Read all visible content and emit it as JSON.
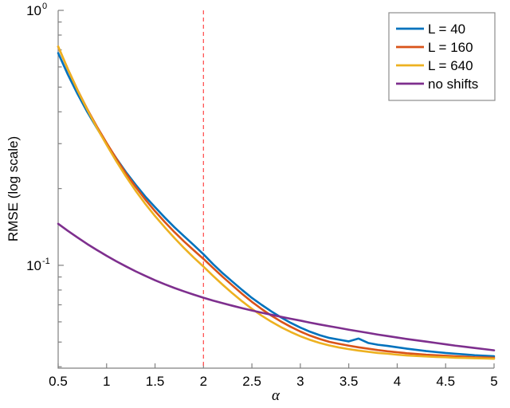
{
  "chart_data": {
    "type": "line",
    "title": "",
    "xlabel": "α",
    "ylabel": "RMSE (log scale)",
    "xscale": "linear",
    "yscale": "log",
    "xlim": [
      0.5,
      5
    ],
    "ylim": [
      0.0395,
      1.0
    ],
    "grid": false,
    "legend_position": "top-right",
    "xticks": [
      0.5,
      1,
      1.5,
      2,
      2.5,
      3,
      3.5,
      4,
      4.5,
      5
    ],
    "xticklabels": [
      "0.5",
      "1",
      "1.5",
      "2",
      "2.5",
      "3",
      "3.5",
      "4",
      "4.5",
      "5"
    ],
    "yticks": [
      1.0,
      0.1
    ],
    "yticklabels": [
      "10^0",
      "10^-1"
    ],
    "yticklabel_parts": [
      {
        "base": "10",
        "sup": "0",
        "value": 1.0
      },
      {
        "base": "10",
        "sup": "-1",
        "value": 0.1
      }
    ],
    "yminorticks": [
      0.9,
      0.8,
      0.7,
      0.6,
      0.5,
      0.4,
      0.3,
      0.2,
      0.09,
      0.08,
      0.07,
      0.06,
      0.05,
      0.04
    ],
    "annotations": [
      {
        "name": "alpha-threshold-line",
        "type": "vline",
        "x": 2,
        "color": "#FF5555",
        "style": "dashed"
      }
    ],
    "x": [
      0.5,
      0.6,
      0.7,
      0.8,
      0.9,
      1.0,
      1.1,
      1.2,
      1.3,
      1.4,
      1.5,
      1.6,
      1.7,
      1.8,
      1.9,
      2.0,
      2.1,
      2.2,
      2.3,
      2.4,
      2.5,
      2.6,
      2.7,
      2.8,
      2.9,
      3.0,
      3.1,
      3.2,
      3.3,
      3.4,
      3.5,
      3.6,
      3.7,
      3.8,
      3.9,
      4.0,
      4.1,
      4.2,
      4.3,
      4.4,
      4.5,
      4.6,
      4.7,
      4.8,
      4.9,
      5.0
    ],
    "series": [
      {
        "name": "L = 40",
        "color": "#0072BD",
        "values": [
          0.68,
          0.56,
          0.47,
          0.4,
          0.345,
          0.3,
          0.263,
          0.232,
          0.207,
          0.186,
          0.169,
          0.154,
          0.141,
          0.13,
          0.12,
          0.1105,
          0.101,
          0.093,
          0.0862,
          0.08,
          0.0745,
          0.07,
          0.066,
          0.0625,
          0.0595,
          0.057,
          0.0549,
          0.0532,
          0.0519,
          0.0511,
          0.0503,
          0.0516,
          0.0496,
          0.0488,
          0.0483,
          0.0477,
          0.0471,
          0.0466,
          0.0461,
          0.0457,
          0.0453,
          0.045,
          0.0447,
          0.0444,
          0.0442,
          0.044
        ]
      },
      {
        "name": "L = 160",
        "color": "#D95319",
        "values": [
          0.72,
          0.588,
          0.487,
          0.41,
          0.35,
          0.302,
          0.262,
          0.229,
          0.203,
          0.181,
          0.163,
          0.148,
          0.135,
          0.124,
          0.1145,
          0.106,
          0.0976,
          0.09,
          0.0833,
          0.0772,
          0.0719,
          0.0674,
          0.0635,
          0.0602,
          0.0574,
          0.055,
          0.053,
          0.0514,
          0.0501,
          0.0492,
          0.0484,
          0.0477,
          0.0471,
          0.0465,
          0.046,
          0.0456,
          0.0452,
          0.0449,
          0.0446,
          0.0444,
          0.0442,
          0.044,
          0.0438,
          0.0436,
          0.0435,
          0.0434
        ]
      },
      {
        "name": "L = 640",
        "color": "#EDB120",
        "values": [
          0.722,
          0.588,
          0.486,
          0.408,
          0.346,
          0.297,
          0.256,
          0.223,
          0.196,
          0.174,
          0.156,
          0.141,
          0.128,
          0.1168,
          0.1072,
          0.0988,
          0.0908,
          0.0838,
          0.0776,
          0.0722,
          0.0675,
          0.0635,
          0.0601,
          0.0572,
          0.0548,
          0.0527,
          0.051,
          0.0496,
          0.0485,
          0.0476,
          0.0469,
          0.0463,
          0.0458,
          0.0453,
          0.045,
          0.0446,
          0.0443,
          0.0441,
          0.0439,
          0.0437,
          0.0436,
          0.0434,
          0.0433,
          0.0432,
          0.0431,
          0.043
        ]
      },
      {
        "name": "no shifts",
        "color": "#7E2F8E",
        "values": [
          0.1455,
          0.1365,
          0.1285,
          0.1212,
          0.1148,
          0.109,
          0.1037,
          0.099,
          0.0947,
          0.0909,
          0.0874,
          0.0843,
          0.0815,
          0.079,
          0.0767,
          0.0746,
          0.0727,
          0.071,
          0.0694,
          0.0679,
          0.0665,
          0.0652,
          0.064,
          0.0628,
          0.0617,
          0.0607,
          0.0596,
          0.0586,
          0.0577,
          0.0568,
          0.0559,
          0.0551,
          0.0543,
          0.0535,
          0.0528,
          0.0521,
          0.0514,
          0.0508,
          0.0502,
          0.0496,
          0.049,
          0.0484,
          0.0479,
          0.0474,
          0.0469,
          0.0464
        ]
      }
    ]
  },
  "legend": {
    "items": [
      {
        "label": "L = 40",
        "color": "#0072BD"
      },
      {
        "label": "L = 160",
        "color": "#D95319"
      },
      {
        "label": "L = 640",
        "color": "#EDB120"
      },
      {
        "label": "no shifts",
        "color": "#7E2F8E"
      }
    ]
  }
}
